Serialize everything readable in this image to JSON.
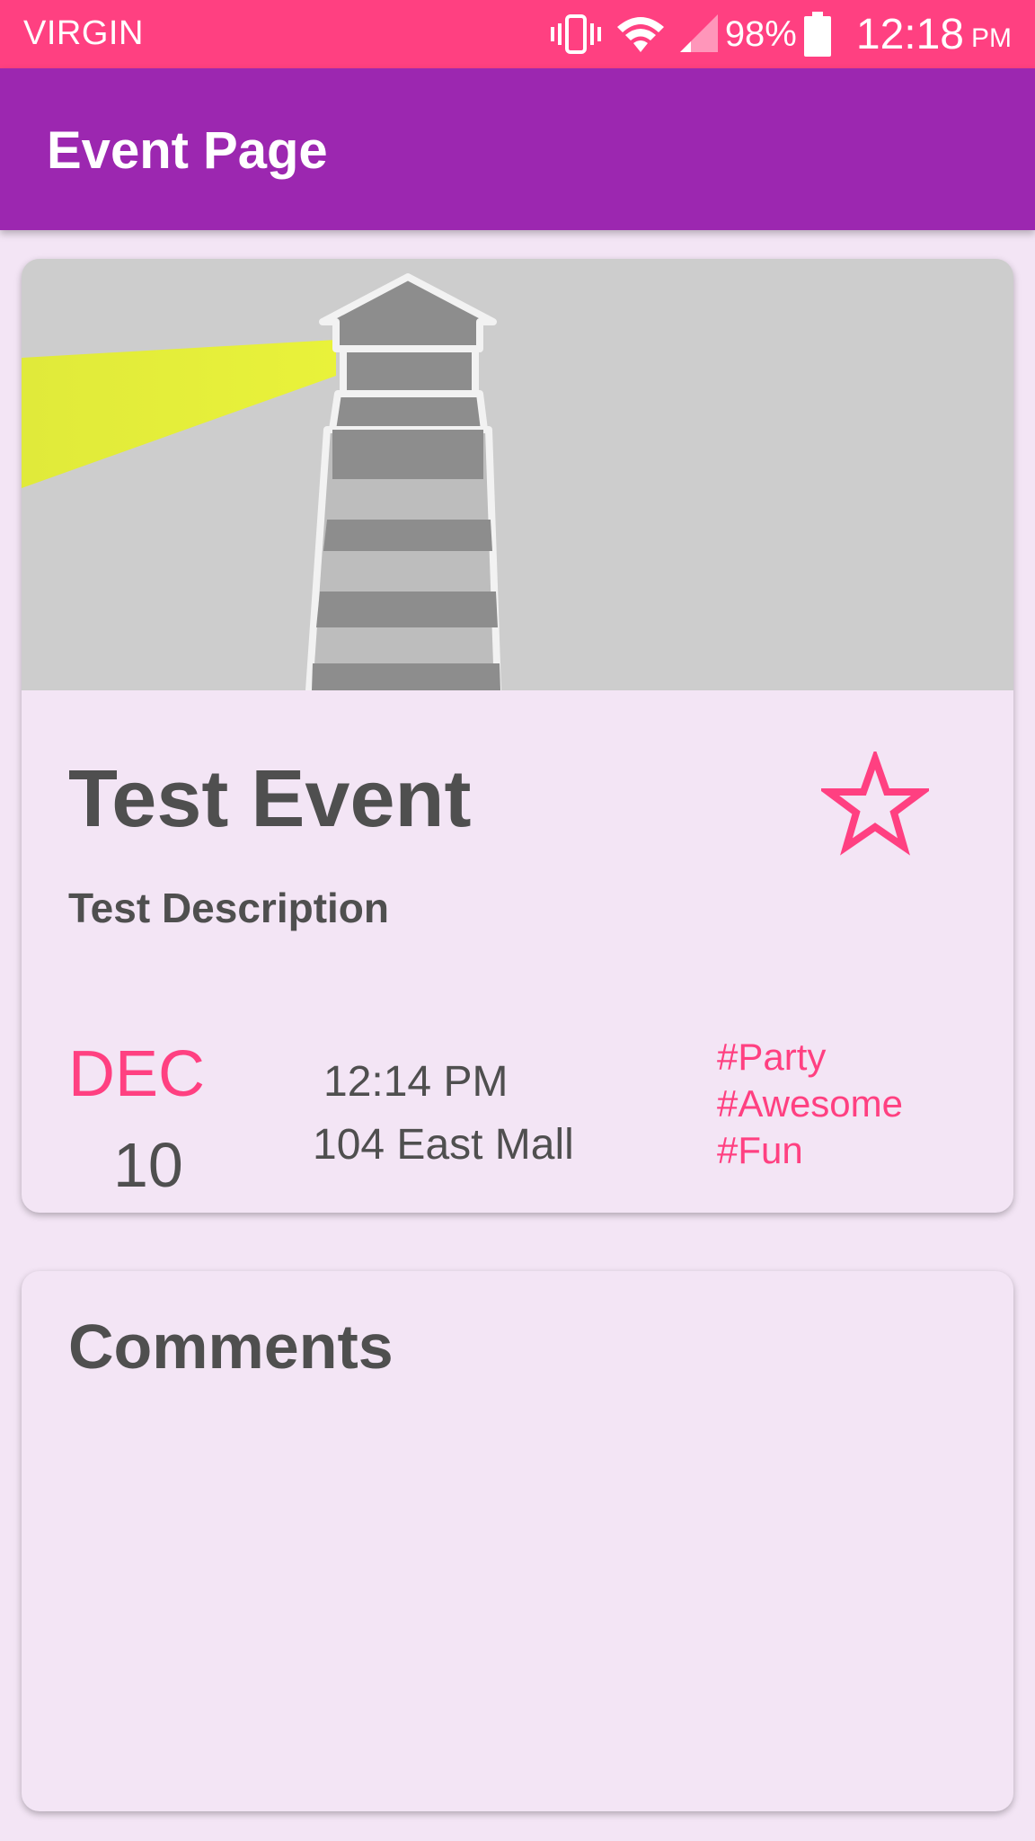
{
  "status_bar": {
    "carrier": "VIRGIN",
    "battery_percent": "98%",
    "time": "12:18",
    "time_suffix": "PM",
    "icons": [
      "vibrate-icon",
      "wifi-icon",
      "signal-icon",
      "battery-icon"
    ]
  },
  "app_bar": {
    "title": "Event Page"
  },
  "event": {
    "banner_icon": "lighthouse-icon",
    "title": "Test Event",
    "description": "Test Description",
    "favorite_icon": "star-outline-icon",
    "date": {
      "month": "DEC",
      "day": "10"
    },
    "time": "12:14 PM",
    "location": "104 East Mall",
    "tags": [
      "#Party",
      "#Awesome",
      "#Fun"
    ]
  },
  "comments": {
    "title": "Comments"
  },
  "colors": {
    "status_bar": "#ff4081",
    "app_bar": "#9c27b0",
    "accent": "#ff4081",
    "background": "#f3e5f5",
    "text": "#4f4f4f"
  }
}
